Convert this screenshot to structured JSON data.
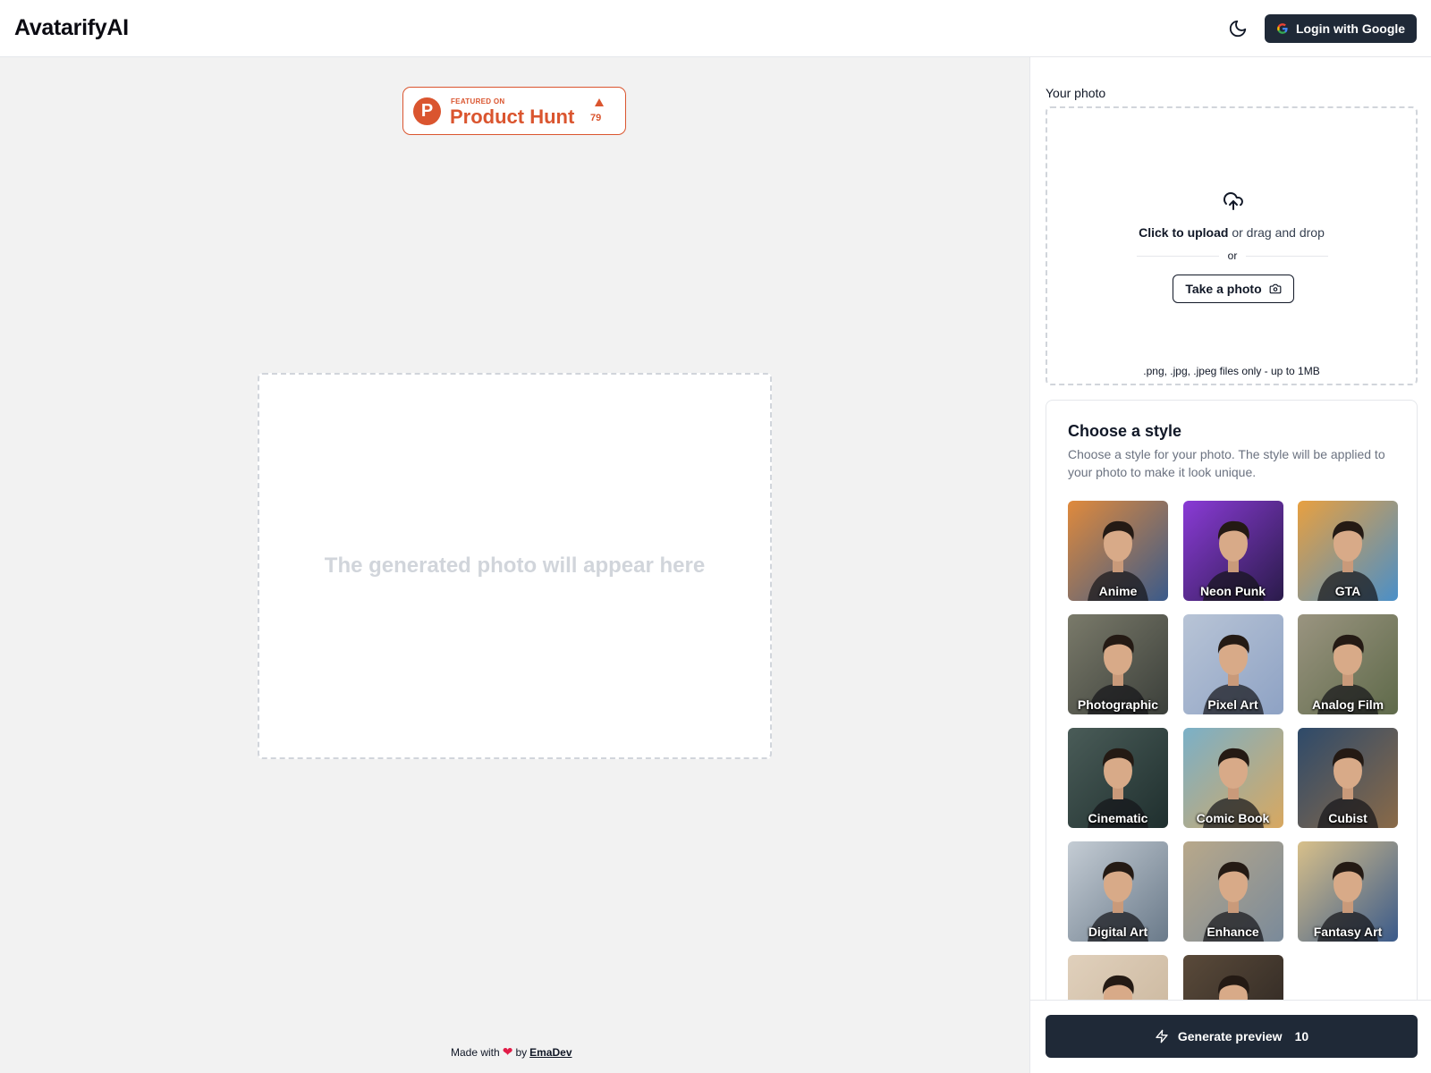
{
  "header": {
    "logo": "AvatarifyAI",
    "theme_icon": "moon-icon",
    "login_label": "Login with Google",
    "login_icon": "google-icon"
  },
  "product_hunt": {
    "featured": "FEATURED ON",
    "title": "Product Hunt",
    "upvotes": "79",
    "color": "#da552f"
  },
  "preview": {
    "placeholder": "The generated photo will appear here"
  },
  "footer": {
    "made_with": "Made with",
    "by": "by",
    "author": "EmaDev"
  },
  "upload": {
    "label": "Your photo",
    "icon": "cloud-upload-icon",
    "click_text": "Click to upload",
    "drag_text": "or drag and drop",
    "or_text": "or",
    "take_photo": "Take a photo",
    "hint": ".png, .jpg, .jpeg files only - up to 1MB"
  },
  "styles": {
    "title": "Choose a style",
    "description": "Choose a style for your photo. The style will be applied to your photo to make it look unique.",
    "items": [
      {
        "label": "Anime",
        "bg1": "#3a5a8a",
        "bg2": "#e08a3c"
      },
      {
        "label": "Neon Punk",
        "bg1": "#2a1b4a",
        "bg2": "#8a3bd6"
      },
      {
        "label": "GTA",
        "bg1": "#4a8fc8",
        "bg2": "#e8a040"
      },
      {
        "label": "Photographic",
        "bg1": "#3b3f3a",
        "bg2": "#7a7a6a"
      },
      {
        "label": "Pixel Art",
        "bg1": "#8ea2c4",
        "bg2": "#b8c4d6"
      },
      {
        "label": "Analog Film",
        "bg1": "#5f6a4a",
        "bg2": "#9a9480"
      },
      {
        "label": "Cinematic",
        "bg1": "#1f2f2e",
        "bg2": "#4a5c58"
      },
      {
        "label": "Comic Book",
        "bg1": "#d8a860",
        "bg2": "#7ab0c8"
      },
      {
        "label": "Cubist",
        "bg1": "#8a6a48",
        "bg2": "#2e4a6a"
      },
      {
        "label": "Digital Art",
        "bg1": "#6a7a8a",
        "bg2": "#c4ccd4"
      },
      {
        "label": "Enhance",
        "bg1": "#7a8a9a",
        "bg2": "#b8a88a"
      },
      {
        "label": "Fantasy Art",
        "bg1": "#3a5a8a",
        "bg2": "#d8c08a"
      },
      {
        "label": "",
        "bg1": "#c8b49a",
        "bg2": "#e0d0bc"
      },
      {
        "label": "",
        "bg1": "#2a2420",
        "bg2": "#5a4a3a"
      }
    ]
  },
  "generate": {
    "label": "Generate preview",
    "count": "10",
    "icon": "lightning-icon"
  }
}
